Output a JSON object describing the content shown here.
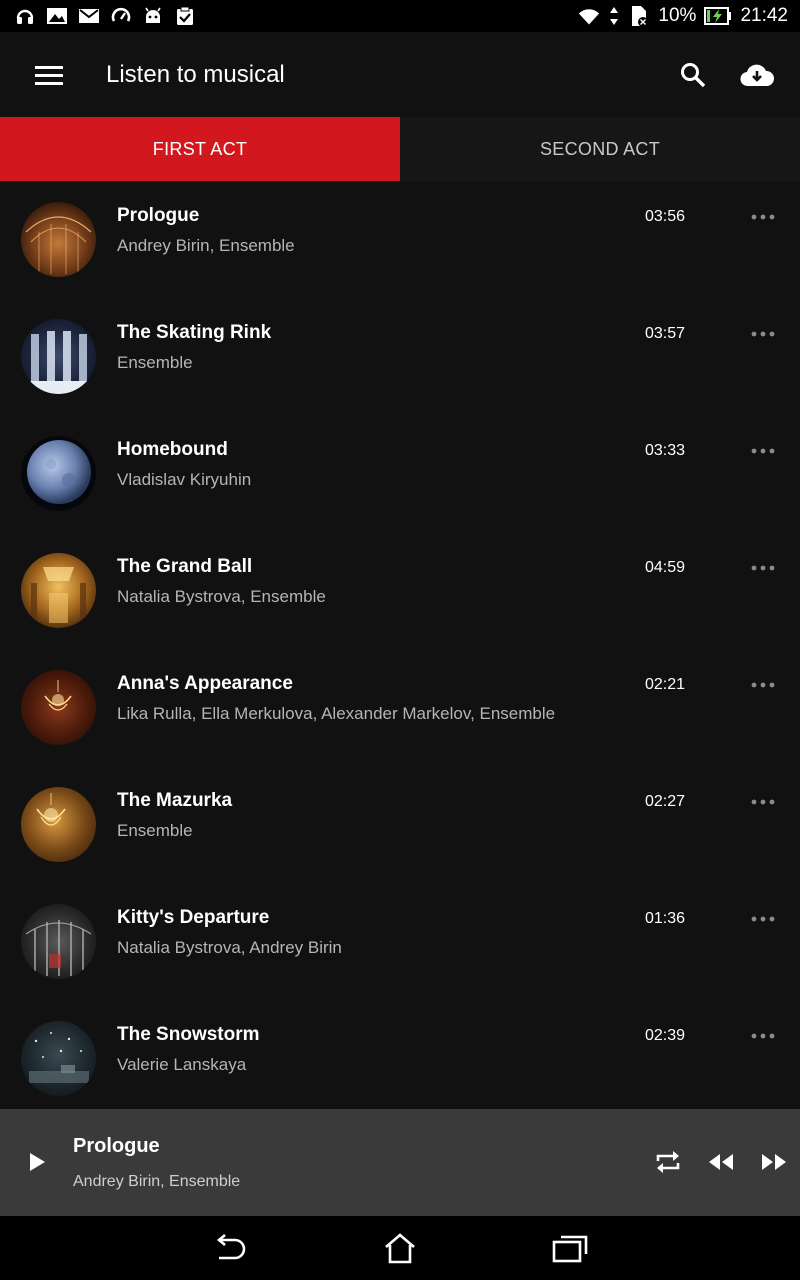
{
  "status_bar": {
    "battery_percent": "10%",
    "time": "21:42",
    "left_icons": [
      "headset-icon",
      "image-icon",
      "mail-icon",
      "speed-icon",
      "android-icon",
      "clipboard-check-icon"
    ],
    "right_icons": [
      "wifi-icon",
      "data-arrows-icon",
      "sim-off-icon",
      "battery-charging-icon"
    ]
  },
  "app_bar": {
    "title": "Listen to musical",
    "icons": [
      "menu-icon",
      "search-icon",
      "cloud-download-icon"
    ]
  },
  "tabs": [
    {
      "label": "FIRST ACT",
      "active": true
    },
    {
      "label": "SECOND ACT",
      "active": false
    }
  ],
  "colors": {
    "accent": "#d3171f",
    "background": "#111111",
    "player_background": "#3a3a3a"
  },
  "tracks": [
    {
      "title": "Prologue",
      "artist": "Andrey Birin, Ensemble",
      "duration": "03:56"
    },
    {
      "title": "The Skating Rink",
      "artist": "Ensemble",
      "duration": "03:57"
    },
    {
      "title": "Homebound",
      "artist": "Vladislav Kiryuhin",
      "duration": "03:33"
    },
    {
      "title": "The Grand Ball",
      "artist": "Natalia Bystrova, Ensemble",
      "duration": "04:59"
    },
    {
      "title": "Anna's Appearance",
      "artist": "Lika Rulla, Ella Merkulova, Alexander Markelov, Ensemble",
      "duration": "02:21"
    },
    {
      "title": "The Mazurka",
      "artist": "Ensemble",
      "duration": "02:27"
    },
    {
      "title": "Kitty's Departure",
      "artist": "Natalia Bystrova, Andrey Birin",
      "duration": "01:36"
    },
    {
      "title": "The Snowstorm",
      "artist": "Valerie Lanskaya",
      "duration": "02:39"
    }
  ],
  "player": {
    "title": "Prologue",
    "artist": "Andrey Birin, Ensemble",
    "icons": [
      "play-icon",
      "repeat-icon",
      "rewind-icon",
      "fast-forward-icon"
    ]
  },
  "nav_bar": {
    "icons": [
      "back-icon",
      "home-icon",
      "recent-apps-icon"
    ]
  }
}
